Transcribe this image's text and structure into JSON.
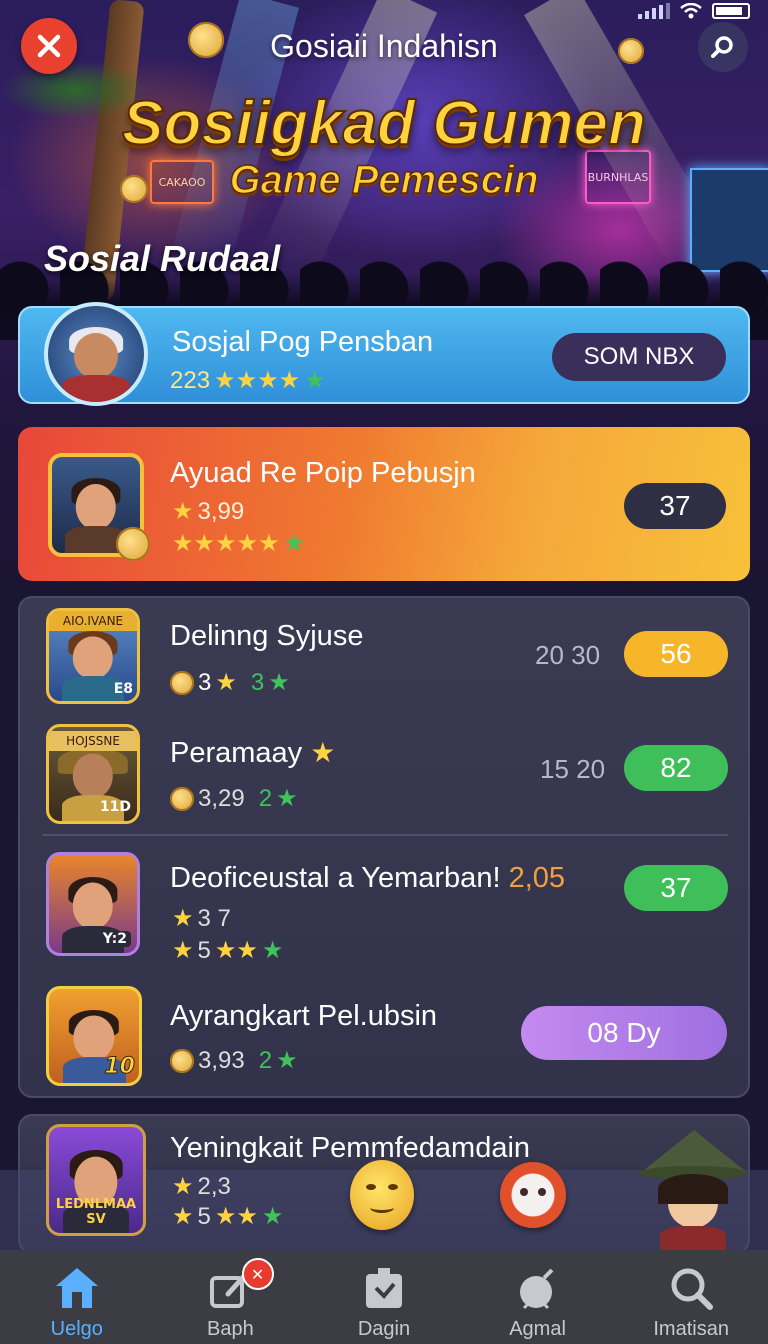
{
  "header": {
    "title": "Gosiaii Indahisn",
    "logo_line1": "Sosiigkad Gumen",
    "logo_line2": "Game Pemescin",
    "section_title": "Sosial Rudaal",
    "signs": [
      "BURNHLAS",
      "CAKAOO"
    ]
  },
  "featured_blue": {
    "name": "Sosjal Pog Pensban",
    "rating_count": "223",
    "stars": 4,
    "button_label": "SOM NBX"
  },
  "featured_orange": {
    "name": "Ayuad Re Poip Pebusjn",
    "rating": "3,99",
    "stars": 5,
    "badge_value": "37"
  },
  "list": [
    {
      "name": "Delinng Syjuse",
      "meta_value": "3",
      "meta_extra": "3",
      "score": "20 30",
      "pill": "56",
      "pill_color": "#f7b52a",
      "tag": "AIO.IVANE",
      "corner": "E8"
    },
    {
      "name": "Peramaay",
      "meta_value": "3,29",
      "meta_extra": "2",
      "score": "15 20",
      "pill": "82",
      "pill_color": "#3fbf5a",
      "tag": "HOJSSNE",
      "corner": "11D"
    },
    {
      "name": "Deoficeustal a Yemarban!",
      "name_suffix": "2,05",
      "meta_value": "3 7",
      "meta_value2": "5",
      "score": "",
      "pill": "37",
      "pill_color": "#3fbf5a",
      "tag": "",
      "corner": "Y:2"
    },
    {
      "name": "Ayrangkart Pel.ubsin",
      "meta_value": "3,93",
      "meta_extra": "2",
      "score": "",
      "pill": "08 Dy",
      "pill_color": "#b47ae8",
      "tag": "",
      "corner": "10"
    }
  ],
  "bottom_item": {
    "name": "Yeningkait Pemmfedamdain",
    "meta_value": "2,3",
    "meta_value2": "5",
    "avatar_label": "LEDNLMAA",
    "avatar_corner": "SV"
  },
  "nav": [
    {
      "label": "Uelgo",
      "icon": "home-icon",
      "active": true
    },
    {
      "label": "Baph",
      "icon": "edit-icon",
      "active": false
    },
    {
      "label": "Dagin",
      "icon": "download-icon",
      "active": false
    },
    {
      "label": "Agmal",
      "icon": "bomb-icon",
      "active": false
    },
    {
      "label": "Imatisan",
      "icon": "search-icon",
      "active": false
    }
  ],
  "colors": {
    "accent_blue": "#4fb8f0",
    "accent_orange": "#f07a30",
    "close_red": "#e8412f",
    "nav_active": "#5ab0ff"
  }
}
